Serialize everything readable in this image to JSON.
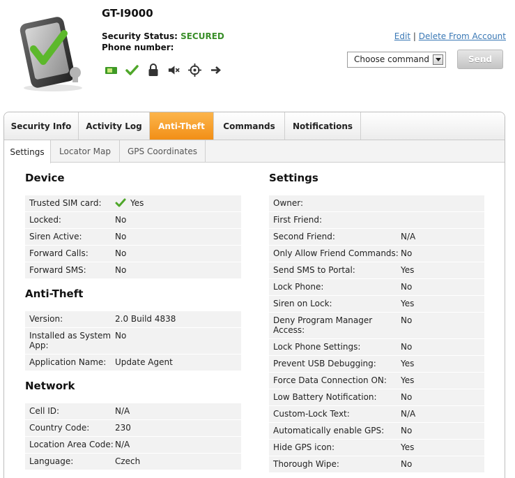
{
  "header": {
    "device_name": "GT-I9000",
    "security_status_label": "Security Status:",
    "security_status_value": "SECURED",
    "phone_number_label": "Phone number:",
    "edit_link": "Edit",
    "separator": "|",
    "delete_link": "Delete From Account",
    "command_select_value": "Choose command",
    "send_label": "Send",
    "status_icons": [
      "sim-card-icon",
      "check-icon",
      "lock-icon",
      "speaker-muted-icon",
      "crosshair-icon",
      "arrow-right-icon"
    ],
    "colors": {
      "secured": "#3a8f2a",
      "link": "#3a78b5",
      "active_tab": "#f59a22"
    }
  },
  "tabs": [
    {
      "label": "Security Info"
    },
    {
      "label": "Activity Log"
    },
    {
      "label": "Anti-Theft",
      "active": true
    },
    {
      "label": "Commands"
    },
    {
      "label": "Notifications"
    }
  ],
  "subtabs": [
    {
      "label": "Settings",
      "active": true
    },
    {
      "label": "Locator Map"
    },
    {
      "label": "GPS Coordinates"
    }
  ],
  "device": {
    "title": "Device",
    "rows": [
      {
        "label": "Trusted SIM card:",
        "value": "Yes"
      },
      {
        "label": "Locked:",
        "value": "No"
      },
      {
        "label": "Siren Active:",
        "value": "No"
      },
      {
        "label": "Forward Calls:",
        "value": "No"
      },
      {
        "label": "Forward SMS:",
        "value": "No"
      }
    ]
  },
  "antitheft": {
    "title": "Anti-Theft",
    "rows": [
      {
        "label": "Version:",
        "value": "2.0 Build 4838"
      },
      {
        "label": "Installed as System App:",
        "value": "No"
      },
      {
        "label": "Application Name:",
        "value": "Update Agent"
      }
    ]
  },
  "network": {
    "title": "Network",
    "rows": [
      {
        "label": "Cell ID:",
        "value": "N/A"
      },
      {
        "label": "Country Code:",
        "value": "230"
      },
      {
        "label": "Location Area Code:",
        "value": "N/A"
      },
      {
        "label": "Language:",
        "value": "Czech"
      }
    ]
  },
  "settings": {
    "title": "Settings",
    "rows": [
      {
        "label": "Owner:",
        "value": ""
      },
      {
        "label": "First Friend:",
        "value": ""
      },
      {
        "label": "Second Friend:",
        "value": "N/A"
      },
      {
        "label": "Only Allow Friend Commands:",
        "value": "No"
      },
      {
        "label": "Send SMS to Portal:",
        "value": "Yes"
      },
      {
        "label": "Lock Phone:",
        "value": "No"
      },
      {
        "label": "Siren on Lock:",
        "value": "Yes"
      },
      {
        "label": "Deny Program Manager Access:",
        "value": "No"
      },
      {
        "label": "Lock Phone Settings:",
        "value": "No"
      },
      {
        "label": "Prevent USB Debugging:",
        "value": "Yes"
      },
      {
        "label": "Force Data Connection ON:",
        "value": "Yes"
      },
      {
        "label": "Low Battery Notification:",
        "value": "No"
      },
      {
        "label": "Custom-Lock Text:",
        "value": "N/A"
      },
      {
        "label": "Automatically enable GPS:",
        "value": "No"
      },
      {
        "label": "Hide GPS icon:",
        "value": "Yes"
      },
      {
        "label": "Thorough Wipe:",
        "value": "No"
      }
    ]
  }
}
